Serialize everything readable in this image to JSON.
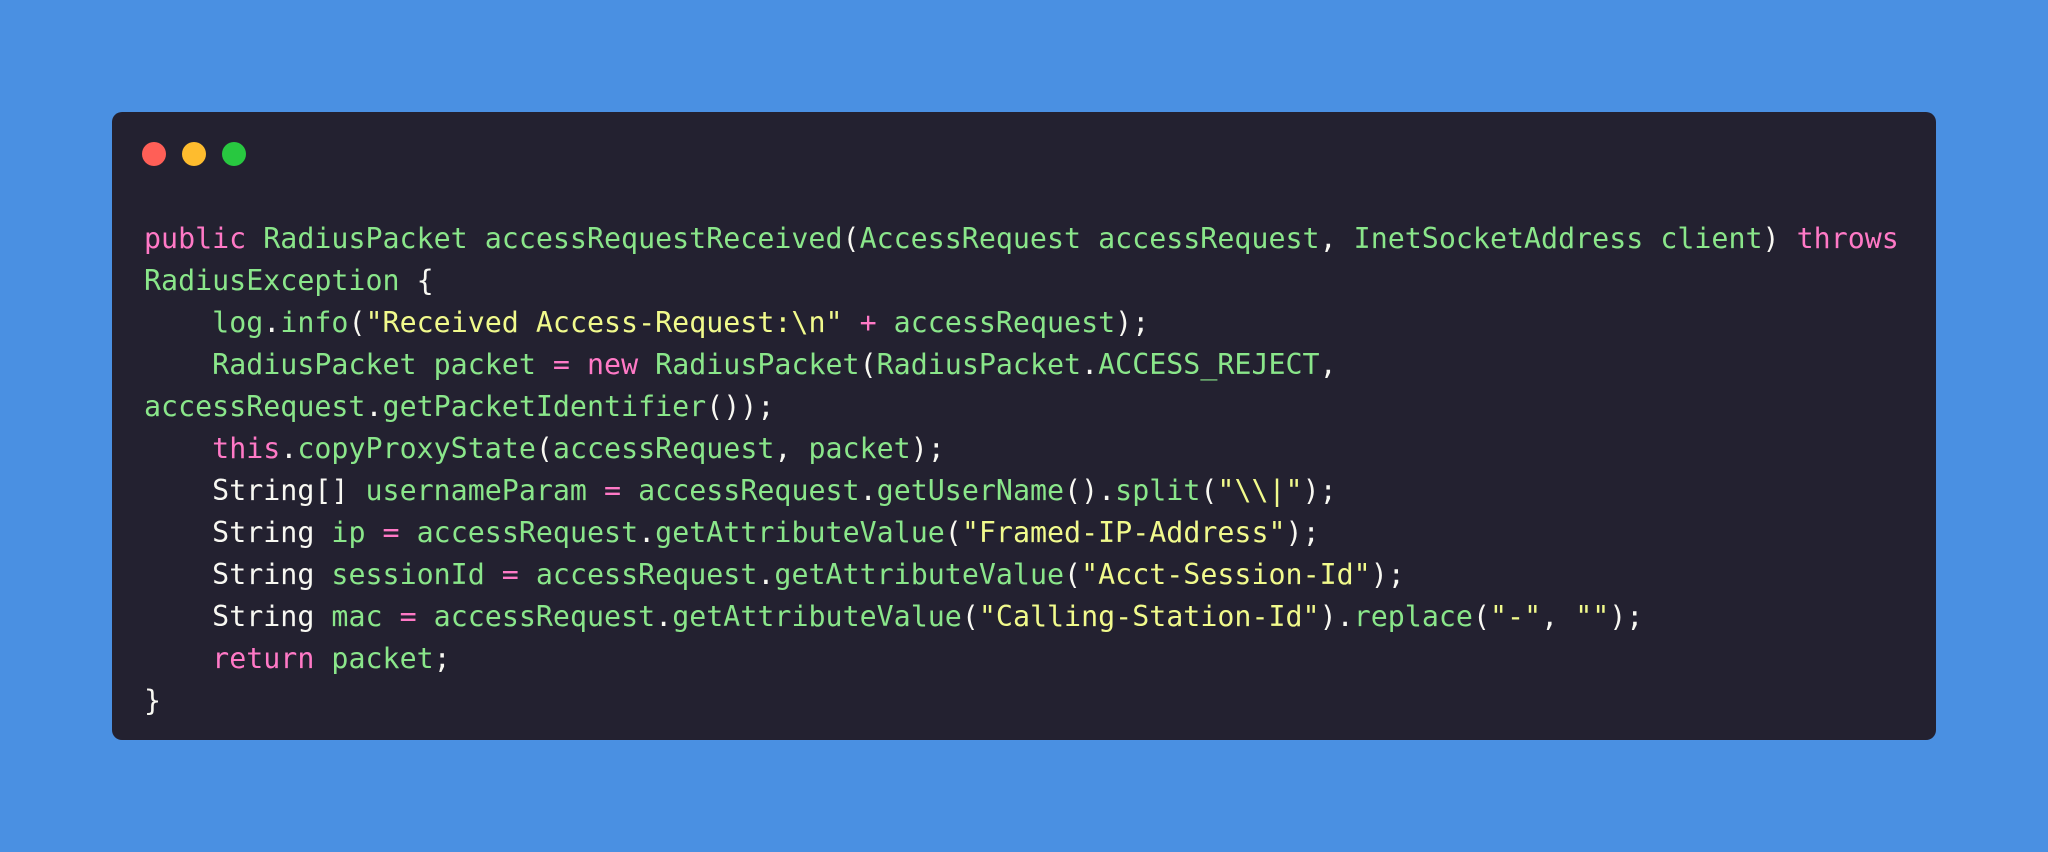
{
  "window": {
    "controls": [
      "close",
      "minimize",
      "maximize"
    ]
  },
  "code": {
    "lines": [
      [
        {
          "t": "public",
          "k": "kw"
        },
        {
          "t": " ",
          "k": "pl"
        },
        {
          "t": "RadiusPacket",
          "k": "ty"
        },
        {
          "t": " ",
          "k": "pl"
        },
        {
          "t": "accessRequestReceived",
          "k": "fn"
        },
        {
          "t": "(",
          "k": "pl"
        },
        {
          "t": "AccessRequest",
          "k": "ty"
        },
        {
          "t": " ",
          "k": "pl"
        },
        {
          "t": "accessRequest",
          "k": "id"
        },
        {
          "t": ", ",
          "k": "pl"
        },
        {
          "t": "InetSocketAddress",
          "k": "ty"
        },
        {
          "t": " ",
          "k": "pl"
        },
        {
          "t": "client",
          "k": "id"
        },
        {
          "t": ") ",
          "k": "pl"
        },
        {
          "t": "throws",
          "k": "kw"
        }
      ],
      [
        {
          "t": "RadiusException",
          "k": "ty"
        },
        {
          "t": " {",
          "k": "pl"
        }
      ],
      [
        {
          "t": "    ",
          "k": "pl"
        },
        {
          "t": "log",
          "k": "id"
        },
        {
          "t": ".",
          "k": "pl"
        },
        {
          "t": "info",
          "k": "fn"
        },
        {
          "t": "(",
          "k": "pl"
        },
        {
          "t": "\"Received Access-Request:\\n\"",
          "k": "str"
        },
        {
          "t": " ",
          "k": "pl"
        },
        {
          "t": "+",
          "k": "op"
        },
        {
          "t": " ",
          "k": "pl"
        },
        {
          "t": "accessRequest",
          "k": "id"
        },
        {
          "t": ");",
          "k": "pl"
        }
      ],
      [
        {
          "t": "    ",
          "k": "pl"
        },
        {
          "t": "RadiusPacket",
          "k": "ty"
        },
        {
          "t": " ",
          "k": "pl"
        },
        {
          "t": "packet",
          "k": "id"
        },
        {
          "t": " ",
          "k": "pl"
        },
        {
          "t": "=",
          "k": "op"
        },
        {
          "t": " ",
          "k": "pl"
        },
        {
          "t": "new",
          "k": "kw"
        },
        {
          "t": " ",
          "k": "pl"
        },
        {
          "t": "RadiusPacket",
          "k": "ty"
        },
        {
          "t": "(",
          "k": "pl"
        },
        {
          "t": "RadiusPacket",
          "k": "ty"
        },
        {
          "t": ".",
          "k": "pl"
        },
        {
          "t": "ACCESS_REJECT",
          "k": "id"
        },
        {
          "t": ",",
          "k": "pl"
        }
      ],
      [
        {
          "t": "accessRequest",
          "k": "id"
        },
        {
          "t": ".",
          "k": "pl"
        },
        {
          "t": "getPacketIdentifier",
          "k": "fn"
        },
        {
          "t": "());",
          "k": "pl"
        }
      ],
      [
        {
          "t": "    ",
          "k": "pl"
        },
        {
          "t": "this",
          "k": "kw"
        },
        {
          "t": ".",
          "k": "pl"
        },
        {
          "t": "copyProxyState",
          "k": "fn"
        },
        {
          "t": "(",
          "k": "pl"
        },
        {
          "t": "accessRequest",
          "k": "id"
        },
        {
          "t": ", ",
          "k": "pl"
        },
        {
          "t": "packet",
          "k": "id"
        },
        {
          "t": ");",
          "k": "pl"
        }
      ],
      [
        {
          "t": "    ",
          "k": "pl"
        },
        {
          "t": "String[]",
          "k": "pl"
        },
        {
          "t": " ",
          "k": "pl"
        },
        {
          "t": "usernameParam",
          "k": "id"
        },
        {
          "t": " ",
          "k": "pl"
        },
        {
          "t": "=",
          "k": "op"
        },
        {
          "t": " ",
          "k": "pl"
        },
        {
          "t": "accessRequest",
          "k": "id"
        },
        {
          "t": ".",
          "k": "pl"
        },
        {
          "t": "getUserName",
          "k": "fn"
        },
        {
          "t": "().",
          "k": "pl"
        },
        {
          "t": "split",
          "k": "fn"
        },
        {
          "t": "(",
          "k": "pl"
        },
        {
          "t": "\"\\\\|\"",
          "k": "str"
        },
        {
          "t": ");",
          "k": "pl"
        }
      ],
      [
        {
          "t": "    ",
          "k": "pl"
        },
        {
          "t": "String",
          "k": "pl"
        },
        {
          "t": " ",
          "k": "pl"
        },
        {
          "t": "ip",
          "k": "id"
        },
        {
          "t": " ",
          "k": "pl"
        },
        {
          "t": "=",
          "k": "op"
        },
        {
          "t": " ",
          "k": "pl"
        },
        {
          "t": "accessRequest",
          "k": "id"
        },
        {
          "t": ".",
          "k": "pl"
        },
        {
          "t": "getAttributeValue",
          "k": "fn"
        },
        {
          "t": "(",
          "k": "pl"
        },
        {
          "t": "\"Framed-IP-Address\"",
          "k": "str"
        },
        {
          "t": ");",
          "k": "pl"
        }
      ],
      [
        {
          "t": "    ",
          "k": "pl"
        },
        {
          "t": "String",
          "k": "pl"
        },
        {
          "t": " ",
          "k": "pl"
        },
        {
          "t": "sessionId",
          "k": "id"
        },
        {
          "t": " ",
          "k": "pl"
        },
        {
          "t": "=",
          "k": "op"
        },
        {
          "t": " ",
          "k": "pl"
        },
        {
          "t": "accessRequest",
          "k": "id"
        },
        {
          "t": ".",
          "k": "pl"
        },
        {
          "t": "getAttributeValue",
          "k": "fn"
        },
        {
          "t": "(",
          "k": "pl"
        },
        {
          "t": "\"Acct-Session-Id\"",
          "k": "str"
        },
        {
          "t": ");",
          "k": "pl"
        }
      ],
      [
        {
          "t": "    ",
          "k": "pl"
        },
        {
          "t": "String",
          "k": "pl"
        },
        {
          "t": " ",
          "k": "pl"
        },
        {
          "t": "mac",
          "k": "id"
        },
        {
          "t": " ",
          "k": "pl"
        },
        {
          "t": "=",
          "k": "op"
        },
        {
          "t": " ",
          "k": "pl"
        },
        {
          "t": "accessRequest",
          "k": "id"
        },
        {
          "t": ".",
          "k": "pl"
        },
        {
          "t": "getAttributeValue",
          "k": "fn"
        },
        {
          "t": "(",
          "k": "pl"
        },
        {
          "t": "\"Calling-Station-Id\"",
          "k": "str"
        },
        {
          "t": ").",
          "k": "pl"
        },
        {
          "t": "replace",
          "k": "fn"
        },
        {
          "t": "(",
          "k": "pl"
        },
        {
          "t": "\"-\"",
          "k": "str"
        },
        {
          "t": ", ",
          "k": "pl"
        },
        {
          "t": "\"\"",
          "k": "str"
        },
        {
          "t": ");",
          "k": "pl"
        }
      ],
      [
        {
          "t": "    ",
          "k": "pl"
        },
        {
          "t": "return",
          "k": "kw"
        },
        {
          "t": " ",
          "k": "pl"
        },
        {
          "t": "packet",
          "k": "id"
        },
        {
          "t": ";",
          "k": "pl"
        }
      ],
      [
        {
          "t": "}",
          "k": "pl"
        }
      ]
    ]
  },
  "colors": {
    "background": "#4a90e2",
    "window": "#232130",
    "keyword": "#ff79c6",
    "type": "#8ae68a",
    "string": "#f1fa8c",
    "plain": "#f8f8f2",
    "close": "#ff5f57",
    "minimize": "#febc2e",
    "maximize": "#28c840"
  }
}
